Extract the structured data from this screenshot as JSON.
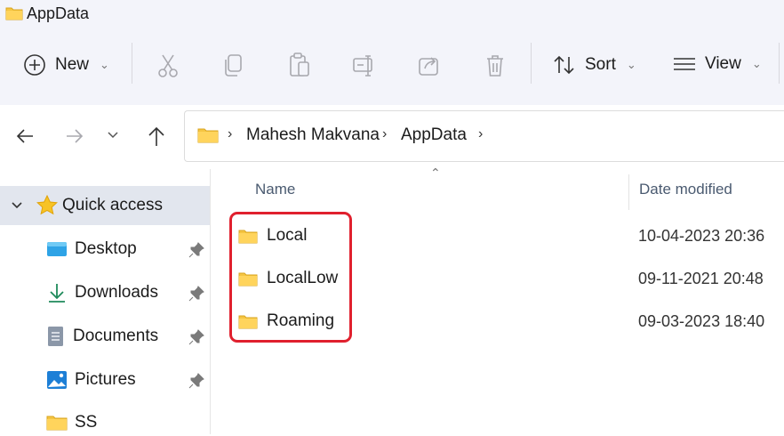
{
  "window": {
    "title": "AppData",
    "title_icon": "folder-icon"
  },
  "toolbar": {
    "new_label": "New",
    "sort_label": "Sort",
    "view_label": "View",
    "icons": [
      "plus-circle-icon",
      "cut-icon",
      "copy-icon",
      "paste-icon",
      "rename-icon",
      "share-icon",
      "delete-icon",
      "sort-icon",
      "view-icon"
    ]
  },
  "address": {
    "crumbs": [
      "Mahesh Makvana",
      "AppData"
    ]
  },
  "sidebar": {
    "quick_access": "Quick access",
    "items": [
      {
        "label": "Desktop",
        "icon": "desktop-icon",
        "pinned": true
      },
      {
        "label": "Downloads",
        "icon": "download-icon",
        "pinned": true
      },
      {
        "label": "Documents",
        "icon": "documents-icon",
        "pinned": true
      },
      {
        "label": "Pictures",
        "icon": "pictures-icon",
        "pinned": true
      },
      {
        "label": "SS",
        "icon": "folder-icon",
        "pinned": false
      }
    ]
  },
  "columns": {
    "name": "Name",
    "date_modified": "Date modified"
  },
  "files": [
    {
      "name": "Local",
      "date": "10-04-2023 20:36"
    },
    {
      "name": "LocalLow",
      "date": "09-11-2021 20:48"
    },
    {
      "name": "Roaming",
      "date": "09-03-2023 18:40"
    }
  ],
  "colors": {
    "folder": "#f5c542",
    "highlight": "#e0202e",
    "toolbar_bg": "#f3f4fa"
  }
}
